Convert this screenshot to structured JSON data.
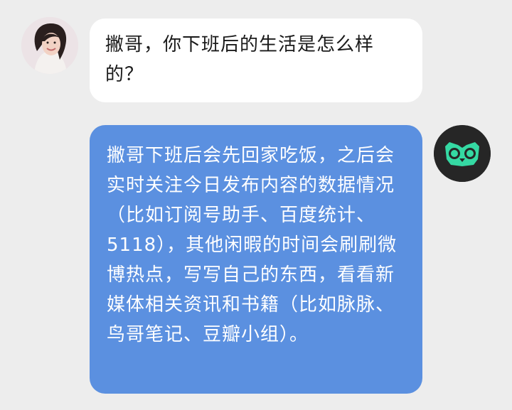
{
  "conversation": {
    "incoming": {
      "avatar_icon": "woman-portrait-avatar",
      "text": "撇哥，你下班后的生活是怎么样的？"
    },
    "outgoing": {
      "avatar_icon": "owl-logo-avatar",
      "avatar_accent": "#35d9a3",
      "bubble_color": "#5b90e0",
      "text": "撇哥下班后会先回家吃饭，之后会实时关注今日发布内容的数据情况（比如订阅号助手、百度统计、5118），其他闲暇的时间会刷刷微博热点，写写自己的东西，看看新媒体相关资讯和书籍（比如脉脉、鸟哥笔记、豆瓣小组）。"
    }
  }
}
